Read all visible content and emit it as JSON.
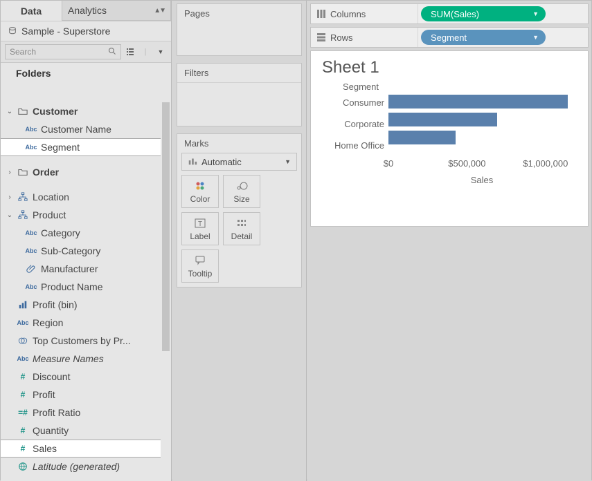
{
  "tabs": {
    "data": "Data",
    "analytics": "Analytics"
  },
  "datasource": "Sample - Superstore",
  "search": {
    "placeholder": "Search"
  },
  "folders_heading": "Folders",
  "tree": {
    "customer": "Customer",
    "customer_name": "Customer Name",
    "segment": "Segment",
    "order": "Order",
    "location": "Location",
    "product": "Product",
    "category": "Category",
    "sub_category": "Sub-Category",
    "manufacturer": "Manufacturer",
    "product_name": "Product Name",
    "profit_bin": "Profit (bin)",
    "region": "Region",
    "top_customers": "Top Customers by Pr...",
    "measure_names": "Measure Names",
    "discount": "Discount",
    "profit": "Profit",
    "profit_ratio": "Profit Ratio",
    "quantity": "Quantity",
    "sales": "Sales",
    "latitude_gen": "Latitude (generated)"
  },
  "mid": {
    "pages": "Pages",
    "filters": "Filters",
    "marks": "Marks",
    "mark_type": "Automatic",
    "color": "Color",
    "size": "Size",
    "label": "Label",
    "detail": "Detail",
    "tooltip": "Tooltip"
  },
  "shelves": {
    "columns_label": "Columns",
    "rows_label": "Rows",
    "columns_pill": "SUM(Sales)",
    "rows_pill": "Segment"
  },
  "viz": {
    "title": "Sheet 1",
    "segment_heading": "Segment",
    "axis_title": "Sales",
    "ticks": {
      "t0": "$0",
      "t1": "$500,000",
      "t2": "$1,000,000"
    }
  },
  "chart_data": {
    "type": "bar",
    "title": "Sheet 1",
    "ylabel": "Segment",
    "xlabel": "Sales",
    "xlim": [
      0,
      1200000
    ],
    "categories": [
      "Consumer",
      "Corporate",
      "Home Office"
    ],
    "values": [
      1150000,
      700000,
      430000
    ]
  }
}
